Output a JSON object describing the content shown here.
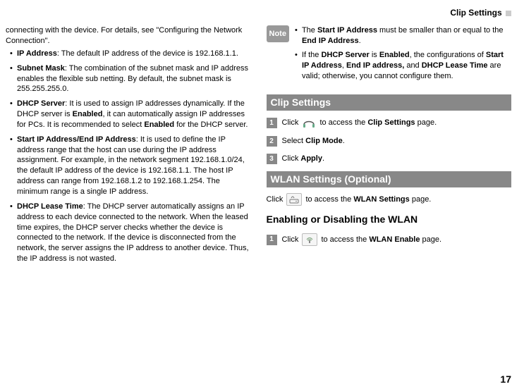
{
  "header_title": "Clip Settings",
  "page_number": "17",
  "left": {
    "intro": "connecting with the device. For details, see \"Configuring the Network Connection\".",
    "items": [
      {
        "term": "IP Address",
        "text": ": The default IP address of the device is 192.168.1.1."
      },
      {
        "term": "Subnet Mask",
        "text": ": The combination of the subnet mask and IP address enables the flexible sub netting. By default, the subnet mask is 255.255.255.0."
      },
      {
        "term": "DHCP Server",
        "text_a": ": It is used to assign IP addresses dynamically. If the DHCP server is ",
        "bold_a": "Enabled",
        "text_b": ", it can automatically assign IP addresses for PCs. It is recommended to select ",
        "bold_b": "Enabled",
        "text_c": " for the DHCP server."
      },
      {
        "term": "Start IP Address/End IP Address",
        "text": ": It is used to define the IP address range that the host can use during the IP address assignment. For example, in the network segment 192.168.1.0/24, the default IP address of the device is 192.168.1.1. The host IP address can range from 192.168.1.2 to 192.168.1.254. The minimum range is a single IP address."
      },
      {
        "term": "DHCP Lease Time",
        "text": ": The DHCP server automatically assigns an IP address to each device connected to the network. When the leased time expires, the DHCP server checks whether the device is connected to the network. If the device is disconnected from the network, the server assigns the IP address to another device. Thus, the IP address is not wasted."
      }
    ]
  },
  "note": {
    "badge": " Note",
    "point1_a": "The ",
    "point1_b1": "Start IP Address",
    "point1_b": " must be smaller than or equal to the ",
    "point1_b2": "End IP Address",
    "point1_c": ".",
    "point2_a": "If the ",
    "point2_b1": "DHCP Server",
    "point2_b": " is ",
    "point2_b2": "Enabled",
    "point2_c": ", the configurations of ",
    "point2_b3": "Start IP Address",
    "point2_d": ", ",
    "point2_b4": "End IP address,",
    "point2_e": " and ",
    "point2_b5": "DHCP Lease Time",
    "point2_f": " are valid; otherwise, you cannot configure them."
  },
  "clip_section": {
    "title": " Clip Settings",
    "step1_a": "Click ",
    "step1_b": " to access the ",
    "step1_bold": "Clip Settings",
    "step1_c": " page.",
    "step2_a": "Select ",
    "step2_bold": "Clip Mode",
    "step2_b": ".",
    "step3_a": "Click ",
    "step3_bold": "Apply",
    "step3_b": "."
  },
  "wlan_section": {
    "title": " WLAN Settings (Optional)",
    "intro_a": "Click ",
    "intro_b": " to access the ",
    "intro_bold": "WLAN Settings",
    "intro_c": " page.",
    "subtitle": "Enabling or Disabling the WLAN",
    "step1_a": "Click ",
    "step1_b": " to access the ",
    "step1_bold": "WLAN Enable",
    "step1_c": " page."
  }
}
